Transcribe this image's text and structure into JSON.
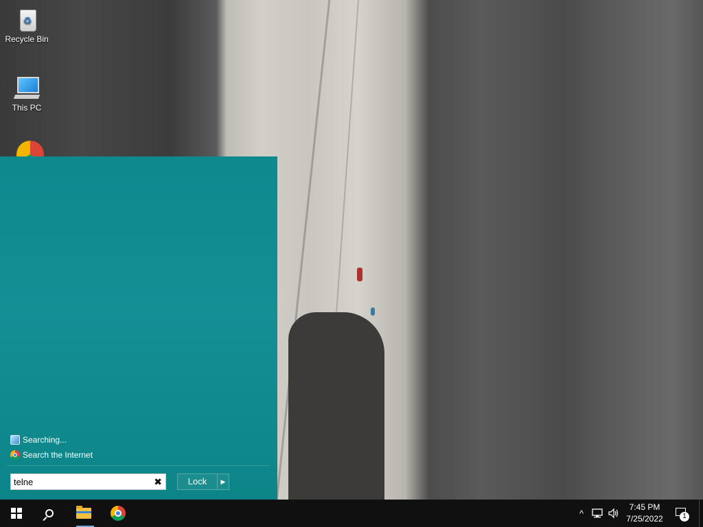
{
  "desktop": {
    "icons": [
      {
        "label": "Recycle Bin",
        "icon": "recycle-bin-icon"
      },
      {
        "label": "This PC",
        "icon": "computer-icon"
      },
      {
        "label": "",
        "icon": "chrome-icon"
      }
    ]
  },
  "start_menu": {
    "results": [
      {
        "label": "Searching...",
        "icon": "search-results-icon"
      },
      {
        "label": "Search the Internet",
        "icon": "chrome-icon"
      }
    ],
    "search": {
      "value": "telne",
      "clear_glyph": "✖"
    },
    "lock_button": {
      "label": "Lock",
      "arrow_glyph": "▶"
    }
  },
  "taskbar": {
    "pinned": [
      {
        "icon": "windows-start-icon"
      },
      {
        "icon": "search-icon"
      },
      {
        "icon": "file-explorer-icon"
      },
      {
        "icon": "chrome-icon"
      }
    ],
    "tray": {
      "chevron_glyph": "^",
      "clock_time": "7:45 PM",
      "clock_date": "7/25/2022",
      "notification_count": "1"
    }
  },
  "colors": {
    "start_menu_bg": "#0d8a8e",
    "taskbar_bg": "#101010",
    "accent": "#7aa7d8"
  }
}
